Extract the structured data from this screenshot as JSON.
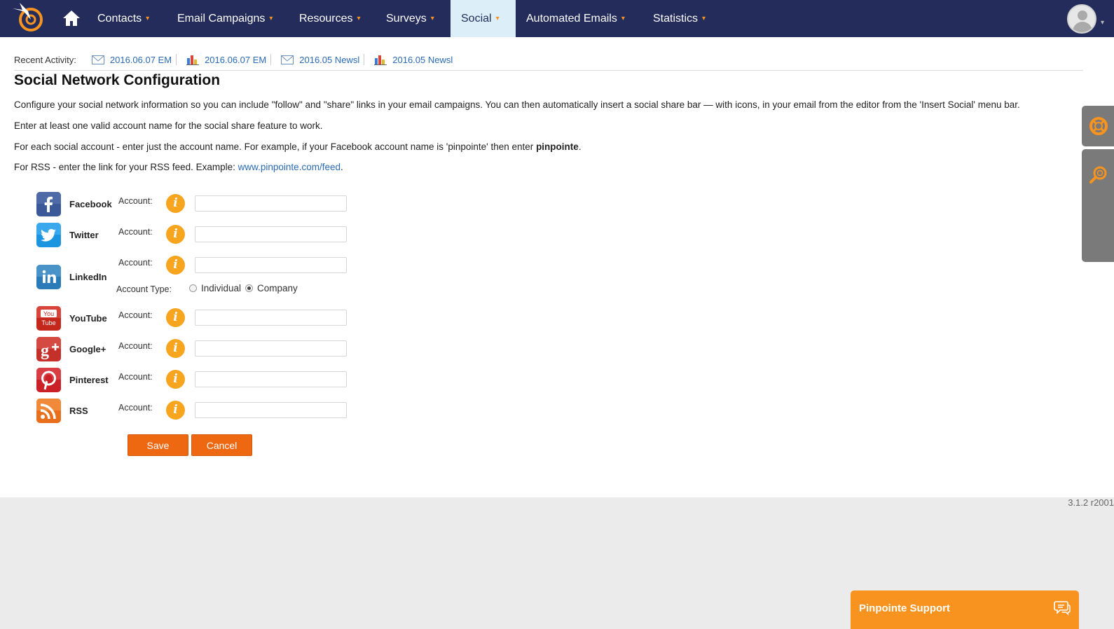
{
  "nav": {
    "items": [
      {
        "label": "Contacts",
        "active": false
      },
      {
        "label": "Email Campaigns",
        "active": false
      },
      {
        "label": "Resources",
        "active": false
      },
      {
        "label": "Surveys",
        "active": false
      },
      {
        "label": "Social",
        "active": true
      },
      {
        "label": "Automated Emails",
        "active": false
      },
      {
        "label": "Statistics",
        "active": false
      }
    ],
    "caret": "▾"
  },
  "recent": {
    "label": "Recent Activity:",
    "items": [
      {
        "label": "2016.06.07 EM",
        "icon": "envelope-icon"
      },
      {
        "label": "2016.06.07 EM",
        "icon": "bar-chart-icon"
      },
      {
        "label": "2016.05 Newsl",
        "icon": "envelope-icon"
      },
      {
        "label": "2016.05 Newsl",
        "icon": "bar-chart-icon"
      }
    ]
  },
  "page": {
    "title": "Social Network Configuration",
    "p1": "Configure your social network information so you can include \"follow\" and \"share\" links in your email campaigns. You can then automatically insert a social share bar — with icons, in your email from the editor from the 'Insert Social' menu bar.",
    "p2": "Enter at least one valid account name for the social share feature to work.",
    "p3_prefix": "For each social account - enter just the account name. For example, if your Facebook account name is 'pinpointe' then enter ",
    "p3_bold": "pinpointe",
    "p3_suffix": ".",
    "p4_prefix": "For RSS - enter the link for your RSS feed. Example: ",
    "p4_link": "www.pinpointe.com/feed",
    "p4_suffix": "."
  },
  "form": {
    "account_label": "Account:",
    "info_glyph": "i",
    "accounts": [
      {
        "name": "Facebook",
        "value": "",
        "color": "#3b5998"
      },
      {
        "name": "Twitter",
        "value": "",
        "color": "#1da1f2"
      },
      {
        "name": "LinkedIn",
        "value": "",
        "color": "#2b7bb9"
      },
      {
        "name": "YouTube",
        "value": "",
        "color": "#cc2b1f"
      },
      {
        "name": "Google+",
        "value": "",
        "color": "#c5302a"
      },
      {
        "name": "Pinterest",
        "value": "",
        "color": "#cb2027"
      },
      {
        "name": "RSS",
        "value": "",
        "color": "#ee7822"
      }
    ],
    "account_type_label": "Account Type:",
    "account_type_options": [
      {
        "label": "Individual",
        "checked": false
      },
      {
        "label": "Company",
        "checked": true
      }
    ],
    "save_label": "Save",
    "cancel_label": "Cancel"
  },
  "footer": {
    "version": "3.1.2 r2001"
  },
  "support": {
    "label": "Pinpointe Support"
  },
  "colors": {
    "nav_bg": "#232c5a",
    "accent": "#ee6711",
    "link": "#2a6ab5",
    "info": "#f7a51f"
  }
}
